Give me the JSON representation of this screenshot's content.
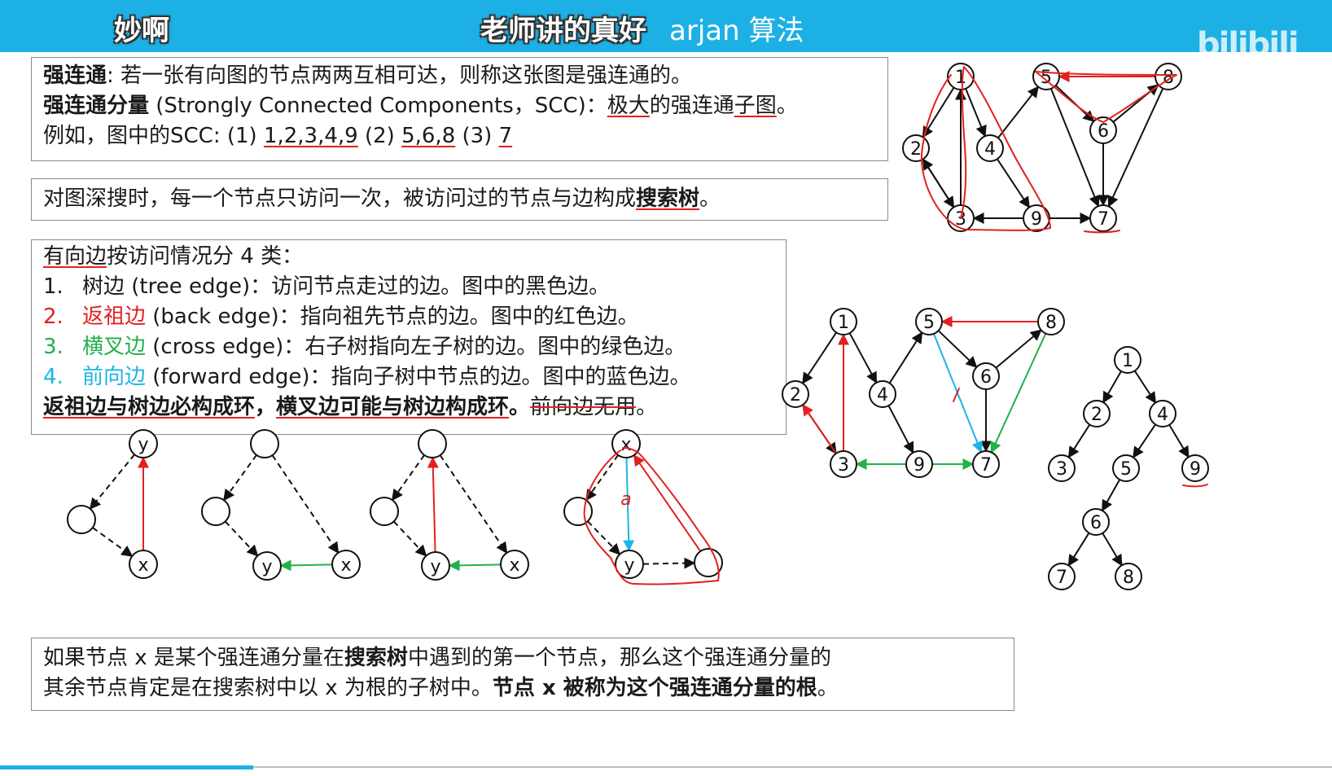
{
  "header": {
    "lecture_title": "arjan 算法",
    "danmaku_1": "妙啊",
    "danmaku_2": "老师讲的真好",
    "watermark_logo": "bilibili"
  },
  "colors": {
    "banner": "#1cb0e4",
    "back_edge": "#e32020",
    "cross_edge": "#22b04a",
    "forward_edge": "#1cb5e6",
    "annotation": "#e32020"
  },
  "definition_box": {
    "line1_term": "强连通",
    "line1_rest": ": 若一张有向图的节点两两互相可达，则称这张图是强连通的。",
    "line2_term": "强连通分量",
    "line2_mid": " (Strongly Connected Components，SCC)：",
    "line2_u1": "极大",
    "line2_mid2": "的强连通",
    "line2_u2": "子图",
    "line2_end": "。",
    "line3_prefix": "例如，图中的SCC: (1) ",
    "scc1": "1,2,3,4,9",
    "sep2": " (2) ",
    "scc2": "5,6,8",
    "sep3": " (3) ",
    "scc3": "7"
  },
  "search_box": {
    "text": "对图深搜时，每一个节点只访问一次，被访问过的节点与边构成",
    "term": "搜索树",
    "end": "。"
  },
  "edge_types": {
    "intro_u": "有向边",
    "intro_rest": "按访问情况分 4 类：",
    "items": [
      {
        "num": "1.",
        "name": "树边",
        "desc": " (tree edge)：访问节点走过的边。图中的黑色边。"
      },
      {
        "num": "2.",
        "name": "返祖边",
        "desc": " (back edge)：指向祖先节点的边。图中的红色边。"
      },
      {
        "num": "3.",
        "name": "横叉边",
        "desc": " (cross edge)：右子树指向左子树的边。图中的绿色边。"
      },
      {
        "num": "4.",
        "name": "前向边",
        "desc": " (forward edge)：指向子树中节点的边。图中的蓝色边。"
      }
    ],
    "conclusion_1": "返祖边与树边必构成环",
    "conclusion_comma": "，",
    "conclusion_2": "横叉边可能与树边构成环",
    "conclusion_dot": "。",
    "conclusion_3": "前向边无用",
    "conclusion_end": "。"
  },
  "root_box": {
    "l1_a": "如果节点 x 是某个强连通分量在",
    "l1_term": "搜索树",
    "l1_b": "中遇到的第一个节点，那么这个强连通分量的",
    "l2_a": "其余节点肯定是在搜索树中以 x 为根的子树中。",
    "l2_bold": "节点 x 被称为这个强连通分量的根",
    "l2_end": "。"
  },
  "graph_nodes": [
    "1",
    "2",
    "3",
    "4",
    "5",
    "6",
    "7",
    "8",
    "9"
  ],
  "small_diagram_labels": {
    "x": "x",
    "y": "y",
    "annotation_glyph": "a"
  },
  "video": {
    "progress_percent": 19
  }
}
